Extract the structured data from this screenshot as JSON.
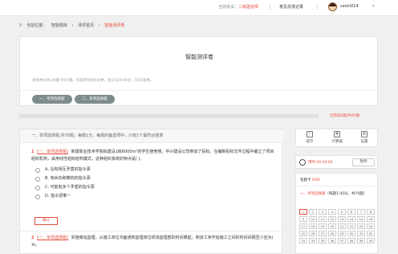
{
  "topbar": {
    "exam_label": "当前考试：",
    "exam_select": "二级建造师",
    "feedback": "意见反馈记录",
    "username": "ceshi014"
  },
  "breadcrumb": {
    "prefix": "当前位置：",
    "items": [
      "智能题库",
      "测评首页",
      "智能测评卷"
    ]
  },
  "paper": {
    "title": "智能测评卷",
    "description": "本卷共分为2大题 95小题，作答时间为0分钟，总分120.00分，72分及格。",
    "section_tabs": [
      "一、单项选择题",
      "二、多项选择题"
    ]
  },
  "progress": {
    "answered": 0,
    "total": 95,
    "text": "已完成0题/共95题"
  },
  "section_header": "一、单项选择题,共70题，每题1分，每题的备选项中，只有1个最符合题意",
  "questions": [
    {
      "number": "1",
      "tag": "[一、单项选择题]",
      "text": "新建职业技术学院拟建设1栋6000m²的学生宿舍楼，中兴建设公司参加了投标。在编制投标文件过程中编立了项目组织机构，采用线性组织结构模式，这种组织系统的特点是(   )。",
      "options": [
        "A. 没有相互矛盾的指令源",
        "B. 有纵向和横向的指令源",
        "C. 可能有多个矛盾的指令源",
        "D. 指令源惟一"
      ]
    },
    {
      "number": "2",
      "tag": "[一、单项选择题]",
      "text": "实施旁站监理，从施工单位书面通知监理单位现场监理部的时间算起，到该工序开始施工之间的时间间隔至少应为(   )h。"
    }
  ],
  "confirm_label": "确认",
  "tools": [
    "提示",
    "计算器",
    "设置"
  ],
  "timer": {
    "label": "用时 00:00:00",
    "pause": "暂停"
  },
  "sheet": {
    "answered_label": "答题卡",
    "answered_count": "0/95",
    "section_label": "一、单项选择题",
    "section_info": "（每题1.00分，共70题）",
    "numbers": [
      "1",
      "2",
      "3",
      "4",
      "5",
      "6",
      "7",
      "8",
      "9",
      "10",
      "11",
      "12",
      "13",
      "14",
      "15",
      "16",
      "17",
      "18",
      "19",
      "20",
      "21",
      "22",
      "23",
      "24",
      "25",
      "26",
      "27",
      "28",
      "29",
      "30",
      "31",
      "32",
      "33",
      "34",
      "35",
      "36",
      "37",
      "38",
      "39",
      "40"
    ]
  }
}
